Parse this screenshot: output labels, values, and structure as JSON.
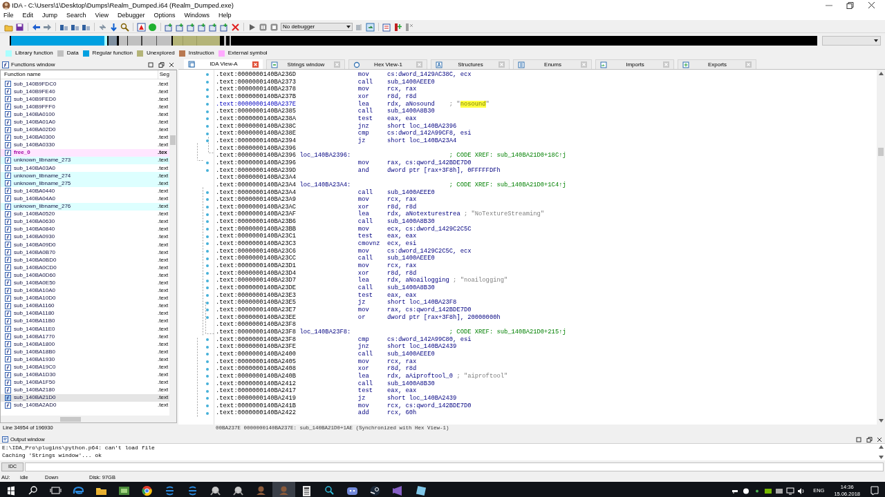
{
  "window": {
    "title": "IDA - C:\\Users\\1\\Desktop\\Dumps\\Realm_Dumped.i64 (Realm_Dumped.exe)"
  },
  "menu": [
    "File",
    "Edit",
    "Jump",
    "Search",
    "View",
    "Debugger",
    "Options",
    "Windows",
    "Help"
  ],
  "toolbar": {
    "debugger_select": "No debugger"
  },
  "legend": [
    {
      "label": "Library function",
      "color": "#aaffff"
    },
    {
      "label": "Data",
      "color": "#c0c0c0"
    },
    {
      "label": "Regular function",
      "color": "#00a0e0"
    },
    {
      "label": "Unexplored",
      "color": "#b4b478"
    },
    {
      "label": "Instruction",
      "color": "#b87850"
    },
    {
      "label": "External symbol",
      "color": "#ffaaff"
    }
  ],
  "functions_window": {
    "title": "Functions window",
    "columns": [
      "Function name",
      "Seg"
    ],
    "status": "Line 34954 of 196930",
    "rows": [
      {
        "name": "sub_140B9FDC0",
        "segment": ".text",
        "kind": "regular",
        "selected": false
      },
      {
        "name": "sub_140B9FE40",
        "segment": ".text",
        "kind": "regular",
        "selected": false
      },
      {
        "name": "sub_140B9FED0",
        "segment": ".text",
        "kind": "regular",
        "selected": false
      },
      {
        "name": "sub_140B9FFF0",
        "segment": ".text",
        "kind": "regular",
        "selected": false
      },
      {
        "name": "sub_140BA0100",
        "segment": ".text",
        "kind": "regular",
        "selected": false
      },
      {
        "name": "sub_140BA01A0",
        "segment": ".text",
        "kind": "regular",
        "selected": false
      },
      {
        "name": "sub_140BA02D0",
        "segment": ".text",
        "kind": "regular",
        "selected": false
      },
      {
        "name": "sub_140BA0300",
        "segment": ".text",
        "kind": "regular",
        "selected": false
      },
      {
        "name": "sub_140BA0330",
        "segment": ".text",
        "kind": "regular",
        "selected": false
      },
      {
        "name": "free_0",
        "segment": ".tex",
        "kind": "external",
        "selected": false
      },
      {
        "name": "unknown_libname_273",
        "segment": ".text",
        "kind": "library",
        "selected": false
      },
      {
        "name": "sub_140BA03A0",
        "segment": ".text",
        "kind": "regular",
        "selected": false
      },
      {
        "name": "unknown_libname_274",
        "segment": ".text",
        "kind": "library",
        "selected": false
      },
      {
        "name": "unknown_libname_275",
        "segment": ".text",
        "kind": "library",
        "selected": false
      },
      {
        "name": "sub_140BA0440",
        "segment": ".text",
        "kind": "regular",
        "selected": false
      },
      {
        "name": "sub_140BA04A0",
        "segment": ".text",
        "kind": "regular",
        "selected": false
      },
      {
        "name": "unknown_libname_276",
        "segment": ".text",
        "kind": "library",
        "selected": false
      },
      {
        "name": "sub_140BA0520",
        "segment": ".text",
        "kind": "regular",
        "selected": false
      },
      {
        "name": "sub_140BA0630",
        "segment": ".text",
        "kind": "regular",
        "selected": false
      },
      {
        "name": "sub_140BA0840",
        "segment": ".text",
        "kind": "regular",
        "selected": false
      },
      {
        "name": "sub_140BA0930",
        "segment": ".text",
        "kind": "regular",
        "selected": false
      },
      {
        "name": "sub_140BA09D0",
        "segment": ".text",
        "kind": "regular",
        "selected": false
      },
      {
        "name": "sub_140BA0B70",
        "segment": ".text",
        "kind": "regular",
        "selected": false
      },
      {
        "name": "sub_140BA0BD0",
        "segment": ".text",
        "kind": "regular",
        "selected": false
      },
      {
        "name": "sub_140BA0CD0",
        "segment": ".text",
        "kind": "regular",
        "selected": false
      },
      {
        "name": "sub_140BA0D60",
        "segment": ".text",
        "kind": "regular",
        "selected": false
      },
      {
        "name": "sub_140BA0E50",
        "segment": ".text",
        "kind": "regular",
        "selected": false
      },
      {
        "name": "sub_140BA10A0",
        "segment": ".text",
        "kind": "regular",
        "selected": false
      },
      {
        "name": "sub_140BA10D0",
        "segment": ".text",
        "kind": "regular",
        "selected": false
      },
      {
        "name": "sub_140BA1160",
        "segment": ".text",
        "kind": "regular",
        "selected": false
      },
      {
        "name": "sub_140BA1180",
        "segment": ".text",
        "kind": "regular",
        "selected": false
      },
      {
        "name": "sub_140BA11B0",
        "segment": ".text",
        "kind": "regular",
        "selected": false
      },
      {
        "name": "sub_140BA11E0",
        "segment": ".text",
        "kind": "regular",
        "selected": false
      },
      {
        "name": "sub_140BA1770",
        "segment": ".text",
        "kind": "regular",
        "selected": false
      },
      {
        "name": "sub_140BA1800",
        "segment": ".text",
        "kind": "regular",
        "selected": false
      },
      {
        "name": "sub_140BA18B0",
        "segment": ".text",
        "kind": "regular",
        "selected": false
      },
      {
        "name": "sub_140BA1930",
        "segment": ".text",
        "kind": "regular",
        "selected": false
      },
      {
        "name": "sub_140BA19C0",
        "segment": ".text",
        "kind": "regular",
        "selected": false
      },
      {
        "name": "sub_140BA1D30",
        "segment": ".text",
        "kind": "regular",
        "selected": false
      },
      {
        "name": "sub_140BA1F50",
        "segment": ".text",
        "kind": "regular",
        "selected": false
      },
      {
        "name": "sub_140BA2180",
        "segment": ".text",
        "kind": "regular",
        "selected": false
      },
      {
        "name": "sub_140BA21D0",
        "segment": ".text",
        "kind": "regular",
        "selected": true
      },
      {
        "name": "sub_140BA2AD0",
        "segment": ".text",
        "kind": "regular",
        "selected": false
      }
    ]
  },
  "tabs": [
    {
      "label": "IDA View-A",
      "selected": true
    },
    {
      "label": "Strings window",
      "selected": false
    },
    {
      "label": "Hex View-1",
      "selected": false
    },
    {
      "label": "Structures",
      "selected": false
    },
    {
      "label": "Enums",
      "selected": false
    },
    {
      "label": "Imports",
      "selected": false
    },
    {
      "label": "Exports",
      "selected": false
    }
  ],
  "disassembly": {
    "status": "00BA237E 0000000140BA237E: sub_140BA21D0+1AE (Synchronized with Hex View-1)",
    "lines": [
      {
        "address": ".text:0000000140BA236D",
        "mnemonic": "mov",
        "operands": "cs:dword_1429AC38C, ecx",
        "current": false
      },
      {
        "address": ".text:0000000140BA2373",
        "mnemonic": "call",
        "operands": "sub_1400AEEE0",
        "current": false
      },
      {
        "address": ".text:0000000140BA2378",
        "mnemonic": "mov",
        "operands": "rcx, rax",
        "current": false
      },
      {
        "address": ".text:0000000140BA237B",
        "mnemonic": "xor",
        "operands": "r8d, r8d",
        "current": false
      },
      {
        "address": ".text:0000000140BA237E",
        "mnemonic": "lea",
        "operands": "rdx, aNosound",
        "comment": {
          "kind": "string",
          "parts": [
            {
              "text": "; \"",
              "highlighted": false
            },
            {
              "text": "nosound",
              "highlighted": true
            },
            {
              "text": "\"",
              "highlighted": false
            }
          ]
        },
        "current": true
      },
      {
        "address": ".text:0000000140BA2385",
        "mnemonic": "call",
        "operands": "sub_1400A8B30",
        "current": false
      },
      {
        "address": ".text:0000000140BA238A",
        "mnemonic": "test",
        "operands": "eax, eax",
        "current": false
      },
      {
        "address": ".text:0000000140BA238C",
        "mnemonic": "jnz",
        "operands": "short loc_140BA2396",
        "current": false
      },
      {
        "address": ".text:0000000140BA238E",
        "mnemonic": "cmp",
        "operands": "cs:dword_142A99CF8, esi",
        "current": false
      },
      {
        "address": ".text:0000000140BA2394",
        "mnemonic": "jz",
        "operands": "short loc_140BA23A4",
        "current": false
      },
      {
        "address": ".text:0000000140BA2396",
        "current": false
      },
      {
        "address": ".text:0000000140BA2396",
        "label": "loc_140BA2396:",
        "comment": {
          "kind": "xref",
          "text": "; CODE XREF: sub_140BA21D0+18C↑j"
        },
        "current": false
      },
      {
        "address": ".text:0000000140BA2396",
        "mnemonic": "mov",
        "operands": "rax, cs:qword_142BDE7D0",
        "current": false
      },
      {
        "address": ".text:0000000140BA239D",
        "mnemonic": "and",
        "operands": "dword ptr [rax+3F8h], 0FFFFFDFh",
        "current": false
      },
      {
        "address": ".text:0000000140BA23A4",
        "current": false
      },
      {
        "address": ".text:0000000140BA23A4",
        "label": "loc_140BA23A4:",
        "comment": {
          "kind": "xref",
          "text": "; CODE XREF: sub_140BA21D0+1C4↑j"
        },
        "current": false
      },
      {
        "address": ".text:0000000140BA23A4",
        "mnemonic": "call",
        "operands": "sub_1400AEEE0",
        "current": false
      },
      {
        "address": ".text:0000000140BA23A9",
        "mnemonic": "mov",
        "operands": "rcx, rax",
        "current": false
      },
      {
        "address": ".text:0000000140BA23AC",
        "mnemonic": "xor",
        "operands": "r8d, r8d",
        "current": false
      },
      {
        "address": ".text:0000000140BA23AF",
        "mnemonic": "lea",
        "operands": "rdx, aNotexturestrea",
        "comment": {
          "kind": "string",
          "text": "; \"NoTextureStreaming\""
        },
        "current": false
      },
      {
        "address": ".text:0000000140BA23B6",
        "mnemonic": "call",
        "operands": "sub_1400A8B30",
        "current": false
      },
      {
        "address": ".text:0000000140BA23BB",
        "mnemonic": "mov",
        "operands": "ecx, cs:dword_1429C2C5C",
        "current": false
      },
      {
        "address": ".text:0000000140BA23C1",
        "mnemonic": "test",
        "operands": "eax, eax",
        "current": false
      },
      {
        "address": ".text:0000000140BA23C3",
        "mnemonic": "cmovnz",
        "operands": "ecx, esi",
        "current": false
      },
      {
        "address": ".text:0000000140BA23C6",
        "mnemonic": "mov",
        "operands": "cs:dword_1429C2C5C, ecx",
        "current": false
      },
      {
        "address": ".text:0000000140BA23CC",
        "mnemonic": "call",
        "operands": "sub_1400AEEE0",
        "current": false
      },
      {
        "address": ".text:0000000140BA23D1",
        "mnemonic": "mov",
        "operands": "rcx, rax",
        "current": false
      },
      {
        "address": ".text:0000000140BA23D4",
        "mnemonic": "xor",
        "operands": "r8d, r8d",
        "current": false
      },
      {
        "address": ".text:0000000140BA23D7",
        "mnemonic": "lea",
        "operands": "rdx, aNoailogging",
        "comment": {
          "kind": "string",
          "text": "; \"noailogging\""
        },
        "current": false
      },
      {
        "address": ".text:0000000140BA23DE",
        "mnemonic": "call",
        "operands": "sub_1400A8B30",
        "current": false
      },
      {
        "address": ".text:0000000140BA23E3",
        "mnemonic": "test",
        "operands": "eax, eax",
        "current": false
      },
      {
        "address": ".text:0000000140BA23E5",
        "mnemonic": "jz",
        "operands": "short loc_140BA23F8",
        "current": false
      },
      {
        "address": ".text:0000000140BA23E7",
        "mnemonic": "mov",
        "operands": "rax, cs:qword_142BDE7D0",
        "current": false
      },
      {
        "address": ".text:0000000140BA23EE",
        "mnemonic": "or",
        "operands": "dword ptr [rax+3F8h], 20000000h",
        "current": false
      },
      {
        "address": ".text:0000000140BA23F8",
        "current": false
      },
      {
        "address": ".text:0000000140BA23F8",
        "label": "loc_140BA23F8:",
        "comment": {
          "kind": "xref",
          "text": "; CODE XREF: sub_140BA21D0+215↑j"
        },
        "current": false
      },
      {
        "address": ".text:0000000140BA23F8",
        "mnemonic": "cmp",
        "operands": "cs:dword_142A99C80, esi",
        "current": false
      },
      {
        "address": ".text:0000000140BA23FE",
        "mnemonic": "jnz",
        "operands": "short loc_140BA2439",
        "current": false
      },
      {
        "address": ".text:0000000140BA2400",
        "mnemonic": "call",
        "operands": "sub_1400AEEE0",
        "current": false
      },
      {
        "address": ".text:0000000140BA2405",
        "mnemonic": "mov",
        "operands": "rcx, rax",
        "current": false
      },
      {
        "address": ".text:0000000140BA2408",
        "mnemonic": "xor",
        "operands": "r8d, r8d",
        "current": false
      },
      {
        "address": ".text:0000000140BA240B",
        "mnemonic": "lea",
        "operands": "rdx, aAiproftool_0",
        "comment": {
          "kind": "string",
          "text": "; \"aiproftool\""
        },
        "current": false
      },
      {
        "address": ".text:0000000140BA2412",
        "mnemonic": "call",
        "operands": "sub_1400A8B30",
        "current": false
      },
      {
        "address": ".text:0000000140BA2417",
        "mnemonic": "test",
        "operands": "eax, eax",
        "current": false
      },
      {
        "address": ".text:0000000140BA2419",
        "mnemonic": "jz",
        "operands": "short loc_140BA2439",
        "current": false
      },
      {
        "address": ".text:0000000140BA241B",
        "mnemonic": "mov",
        "operands": "rcx, cs:qword_142BDE7D0",
        "current": false
      },
      {
        "address": ".text:0000000140BA2422",
        "mnemonic": "add",
        "operands": "rcx, 60h",
        "current": false
      }
    ]
  },
  "output_window": {
    "title": "Output window",
    "lines": [
      "E:\\IDA_Pro\\plugins\\python.p64: can't load file",
      "Caching 'Strings window'... ok"
    ],
    "command_button": "IDC"
  },
  "status_bar": [
    "AU:",
    "idle",
    "Down",
    "Disk: 97GB"
  ],
  "taskbar": {
    "language": "ENG",
    "time": "14:36",
    "date": "15.06.2018"
  }
}
